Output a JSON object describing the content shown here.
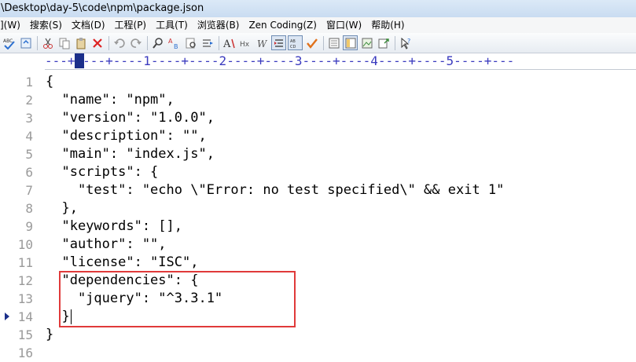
{
  "window": {
    "title": "\\Desktop\\day-5\\code\\npm\\package.json"
  },
  "menu": {
    "items": [
      "](W)",
      "搜索(S)",
      "文档(D)",
      "工程(P)",
      "工具(T)",
      "浏览器(B)",
      "Zen Coding(Z)",
      "窗口(W)",
      "帮助(H)"
    ]
  },
  "ruler": {
    "text": "---+----+----1----+----2----+----3----+----4----+----5----+---"
  },
  "editor": {
    "lines": [
      "{",
      "  \"name\": \"npm\",",
      "  \"version\": \"1.0.0\",",
      "  \"description\": \"\",",
      "  \"main\": \"index.js\",",
      "  \"scripts\": {",
      "    \"test\": \"echo \\\"Error: no test specified\\\" && exit 1\"",
      "  },",
      "  \"keywords\": [],",
      "  \"author\": \"\",",
      "  \"license\": \"ISC\",",
      "  \"dependencies\": {",
      "    \"jquery\": \"^3.3.1\"",
      "  }",
      "}",
      ""
    ],
    "line_numbers": [
      "1",
      "2",
      "3",
      "4",
      "5",
      "6",
      "7",
      "8",
      "9",
      "10",
      "11",
      "12",
      "13",
      "14",
      "15",
      "16"
    ],
    "current_line": 14
  },
  "colors": {
    "highlight_border": "#e03a3a",
    "line_number": "#9a9a9a",
    "ruler_text": "#3b3bbf"
  }
}
